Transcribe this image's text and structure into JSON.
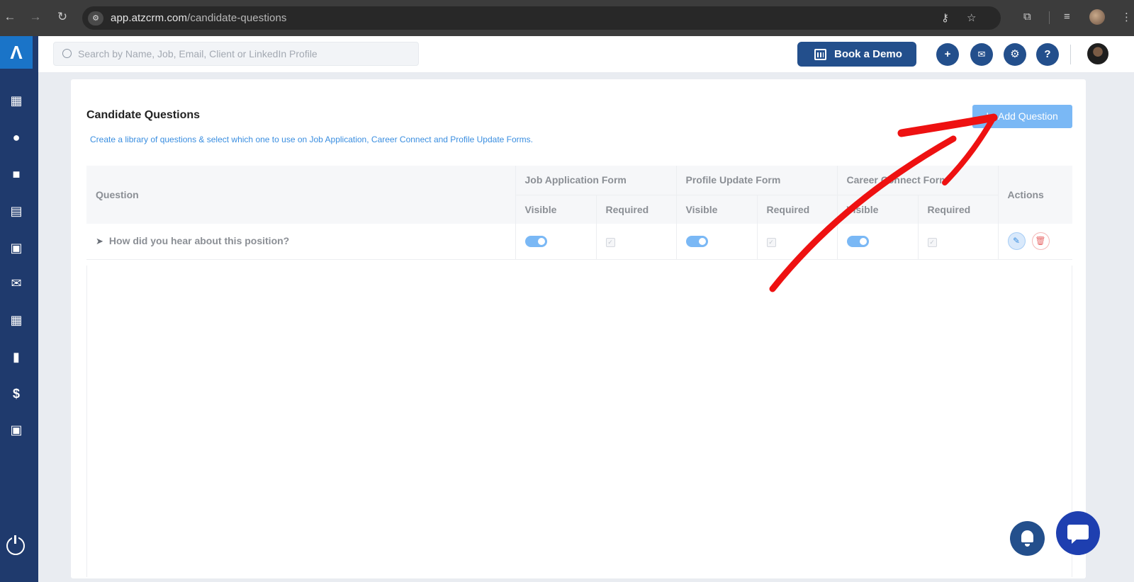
{
  "browser": {
    "url_host": "app.atzcrm.com",
    "url_path": "/candidate-questions",
    "icons": [
      "back-icon",
      "forward-icon",
      "reload-icon",
      "site-info-icon",
      "password-key-icon",
      "bookmark-star-icon",
      "extensions-icon",
      "media-control-icon",
      "profile-avatar",
      "menu-icon"
    ]
  },
  "sidebar": {
    "logo": "Λ",
    "items": [
      {
        "name": "dashboard-icon",
        "glyph": "▦"
      },
      {
        "name": "candidates-icon",
        "glyph": "●"
      },
      {
        "name": "jobs-icon",
        "glyph": "■"
      },
      {
        "name": "clients-icon",
        "glyph": "▤"
      },
      {
        "name": "contacts-icon",
        "glyph": "▣"
      },
      {
        "name": "email-icon",
        "glyph": "✉"
      },
      {
        "name": "calendar-icon",
        "glyph": "▦"
      },
      {
        "name": "reports-icon",
        "glyph": "▮"
      },
      {
        "name": "billing-icon",
        "glyph": "$"
      },
      {
        "name": "placements-icon",
        "glyph": "▣"
      }
    ]
  },
  "topbar": {
    "search_placeholder": "Search by Name, Job, Email, Client or LinkedIn Profile",
    "book_demo_label": "Book a Demo",
    "add_glyph": "+",
    "mail_glyph": "✉",
    "settings_glyph": "⚙",
    "help_glyph": "?"
  },
  "page": {
    "title": "Candidate Questions",
    "subtitle": "Create a library of questions & select which one to use on Job Application, Career Connect and Profile Update Forms.",
    "add_button_label": "Add Question",
    "add_button_glyph": "+"
  },
  "table": {
    "question_header": "Question",
    "actions_header": "Actions",
    "form_groups": [
      "Job Application Form",
      "Profile Update Form",
      "Career Connect Form"
    ],
    "sub_headers": [
      "Visible",
      "Required",
      "Visible",
      "Required",
      "Visible",
      "Required"
    ],
    "rows": [
      {
        "question": "How did you hear about this position?",
        "job_visible": true,
        "job_required": true,
        "profile_visible": true,
        "profile_required": true,
        "career_visible": true,
        "career_required": true
      }
    ],
    "check_glyph": "✓",
    "edit_glyph": "✎",
    "delete_glyph": "🗑"
  },
  "colors": {
    "sidebar": "#1f3a6d",
    "primary": "#234f8c",
    "accent": "#7ab8f5",
    "annotation": "#ee1111"
  }
}
